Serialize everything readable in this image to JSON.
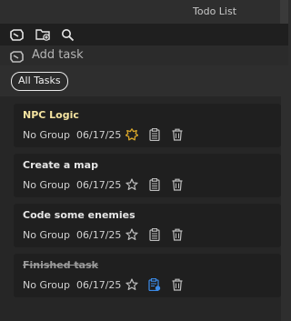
{
  "window": {
    "title": "Todo List"
  },
  "toolbar": {
    "icons": [
      "clip-icon",
      "folder-add-icon",
      "search-icon"
    ]
  },
  "add_task": {
    "label": "Add task",
    "icon": "clip-icon"
  },
  "filter": {
    "label": "All Tasks"
  },
  "tasks": [
    {
      "title": "NPC Logic",
      "group": "No Group",
      "date": "06/17/25",
      "starred": true,
      "state": "highlight"
    },
    {
      "title": "Create a map",
      "group": "No Group",
      "date": "06/17/25",
      "starred": false,
      "state": "normal"
    },
    {
      "title": "Code some enemies",
      "group": "No Group",
      "date": "06/17/25",
      "starred": false,
      "state": "normal"
    },
    {
      "title": "Finished task",
      "group": "No Group",
      "date": "06/17/25",
      "starred": false,
      "state": "done"
    }
  ],
  "colors": {
    "star_active": "#d8a62a",
    "clipboard_active": "#3b8be8",
    "highlight_title": "#f4e3a0"
  }
}
